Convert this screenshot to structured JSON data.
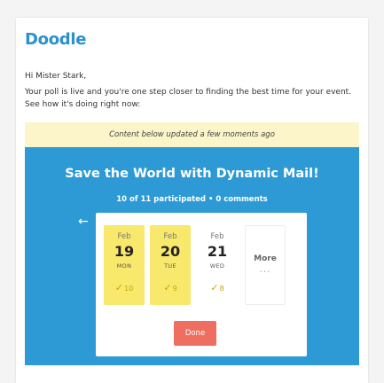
{
  "logo": "Doodle",
  "greeting": "Hi Mister Stark,",
  "intro": "Your poll is live and you're one step closer to finding the best time for your event. See how it's doing right now:",
  "notice": "Content below updated a few moments ago",
  "poll": {
    "title": "Save the World with Dynamic Mail!",
    "subtitle": "10 of 11 participated • 0 comments",
    "back_icon": "arrow-left-icon",
    "options": [
      {
        "month": "Feb",
        "day": "19",
        "weekday": "MON",
        "votes": "10",
        "highlight": true
      },
      {
        "month": "Feb",
        "day": "20",
        "weekday": "TUE",
        "votes": "9",
        "highlight": true
      },
      {
        "month": "Feb",
        "day": "21",
        "weekday": "WED",
        "votes": "8",
        "highlight": false
      }
    ],
    "more_label": "More",
    "more_dots": "...",
    "done_label": "Done"
  },
  "colors": {
    "brand": "#2a90d0",
    "poll_bg": "#2d9ad6",
    "highlight": "#f8e86b",
    "notice_bg": "#fbf5c9",
    "done": "#ee6f61",
    "check": "#c9a600"
  }
}
